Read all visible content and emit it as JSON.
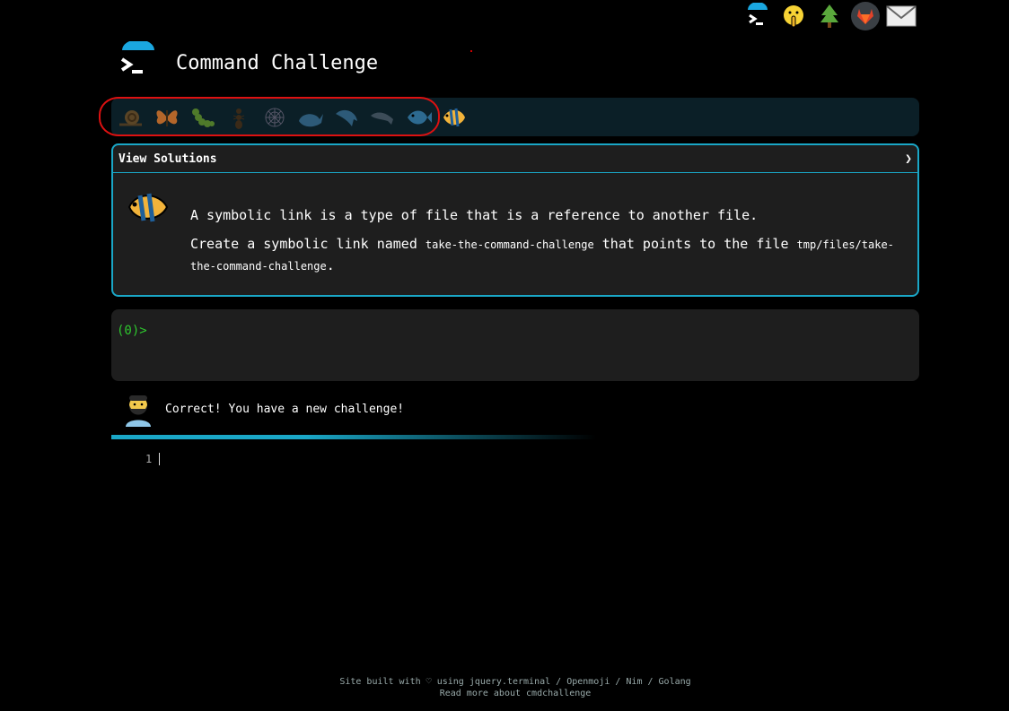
{
  "header": {
    "title": "Command Challenge"
  },
  "topbar": {
    "icons": [
      "terminal-icon",
      "shushing-face-icon",
      "tree-icon",
      "gitlab-icon",
      "envelope-icon"
    ]
  },
  "badges": [
    "snail",
    "butterfly",
    "caterpillar",
    "ant",
    "spider-web",
    "whale",
    "dolphin",
    "dolphin",
    "fish",
    "tropical-fish"
  ],
  "solutions": {
    "label": "View Solutions",
    "chevron": "❯"
  },
  "challenge": {
    "intro": "A symbolic link is a type of file that is a reference to another file.",
    "task_pre": "Create a symbolic link named ",
    "link_name": "take-the-command-challenge",
    "task_mid": " that points to the file ",
    "target_path": "tmp/files/take-the-command-challenge",
    "task_end": "."
  },
  "terminal": {
    "prompt": "(0)>"
  },
  "feedback": {
    "message": "Correct! You have a new challenge!"
  },
  "editor": {
    "line_number": "1"
  },
  "footer": {
    "line1": "Site built with ♡ using jquery.terminal / Openmoji / Nim / Golang",
    "line2": "Read more about cmdchallenge"
  },
  "colors": {
    "accent": "#1aa7c7",
    "prompt": "#2ec82e",
    "annotation": "#dd1111"
  }
}
